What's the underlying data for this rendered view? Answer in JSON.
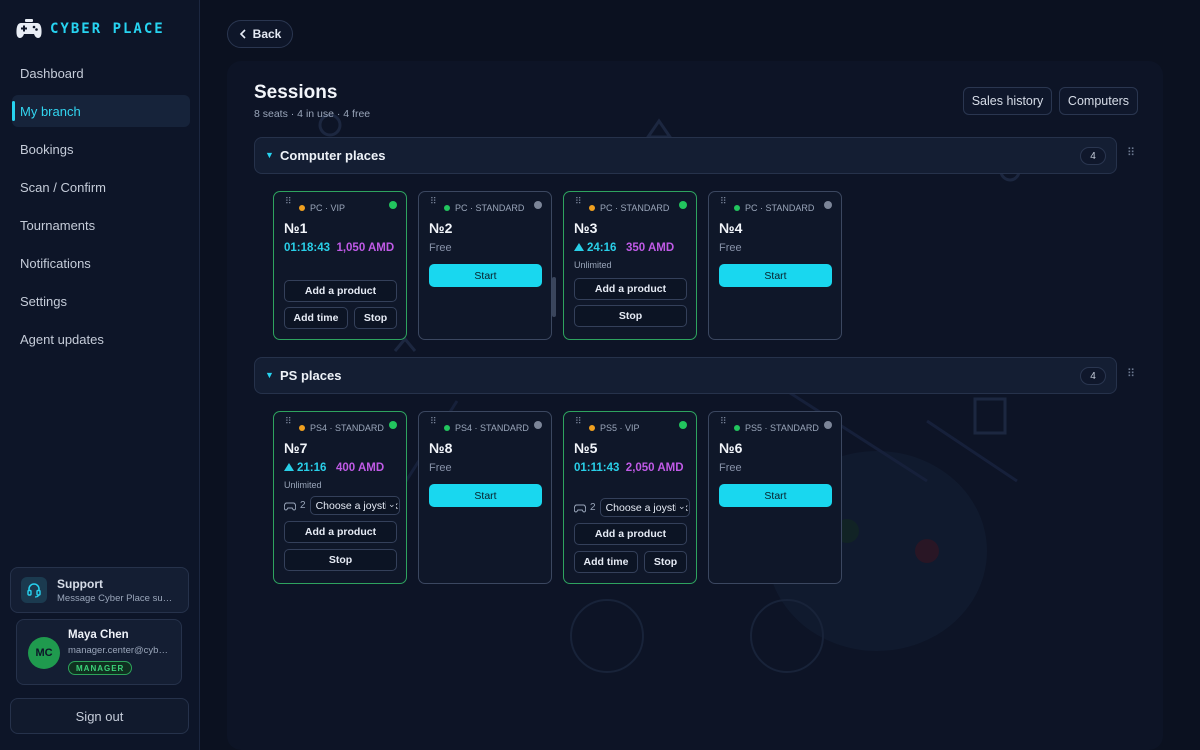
{
  "app": {
    "name": "CYBER PLACE"
  },
  "sidebar": {
    "items": [
      {
        "label": "Dashboard",
        "active": false
      },
      {
        "label": "My branch",
        "active": true
      },
      {
        "label": "Bookings",
        "active": false
      },
      {
        "label": "Scan / Confirm",
        "active": false
      },
      {
        "label": "Tournaments",
        "active": false
      },
      {
        "label": "Notifications",
        "active": false
      },
      {
        "label": "Settings",
        "active": false
      },
      {
        "label": "Agent updates",
        "active": false
      }
    ],
    "support": {
      "title": "Support",
      "subtitle": "Message Cyber Place support"
    },
    "user": {
      "initials": "MC",
      "name": "Maya Chen",
      "email": "manager.center@cyberplace.am",
      "role": "MANAGER"
    },
    "sign_out": "Sign out"
  },
  "header": {
    "back": "Back",
    "title": "Sessions",
    "subtitle": "8 seats · 4 in use · 4 free",
    "sales_history": "Sales history",
    "computers": "Computers"
  },
  "sections": {
    "computer": {
      "title": "Computer places",
      "count": "4"
    },
    "ps": {
      "title": "PS places",
      "count": "4"
    }
  },
  "labels": {
    "free": "Free",
    "start": "Start",
    "add_product": "Add a product",
    "add_time": "Add time",
    "stop": "Stop",
    "unlimited": "Unlimited",
    "choose_joystick": "Choose a joystick"
  },
  "cards": {
    "c1": {
      "head": "PC · VIP",
      "number": "№1",
      "time": "01:18:43",
      "price": "1,050 AMD"
    },
    "c2": {
      "head": "PC · STANDARD",
      "number": "№2"
    },
    "c3": {
      "head": "PC · STANDARD",
      "number": "№3",
      "time": "24:16",
      "price": "350 AMD"
    },
    "c4": {
      "head": "PC · STANDARD",
      "number": "№4"
    },
    "p7": {
      "head": "PS4 · STANDARD",
      "number": "№7",
      "time": "21:16",
      "price": "400 AMD",
      "joysticks": "2"
    },
    "p8": {
      "head": "PS4 · STANDARD",
      "number": "№8"
    },
    "p5": {
      "head": "PS5 · VIP",
      "number": "№5",
      "time": "01:11:43",
      "price": "2,050 AMD",
      "joysticks": "2"
    },
    "p6": {
      "head": "PS5 · STANDARD",
      "number": "№6"
    }
  },
  "colors": {
    "accent": "#19d7ef",
    "active_border": "#2ea35f",
    "status_green": "#22c55e",
    "status_grey": "#7c8598",
    "tier_vip": "#f0a020",
    "tier_standard": "#22c55e",
    "price": "#c05ae6"
  }
}
